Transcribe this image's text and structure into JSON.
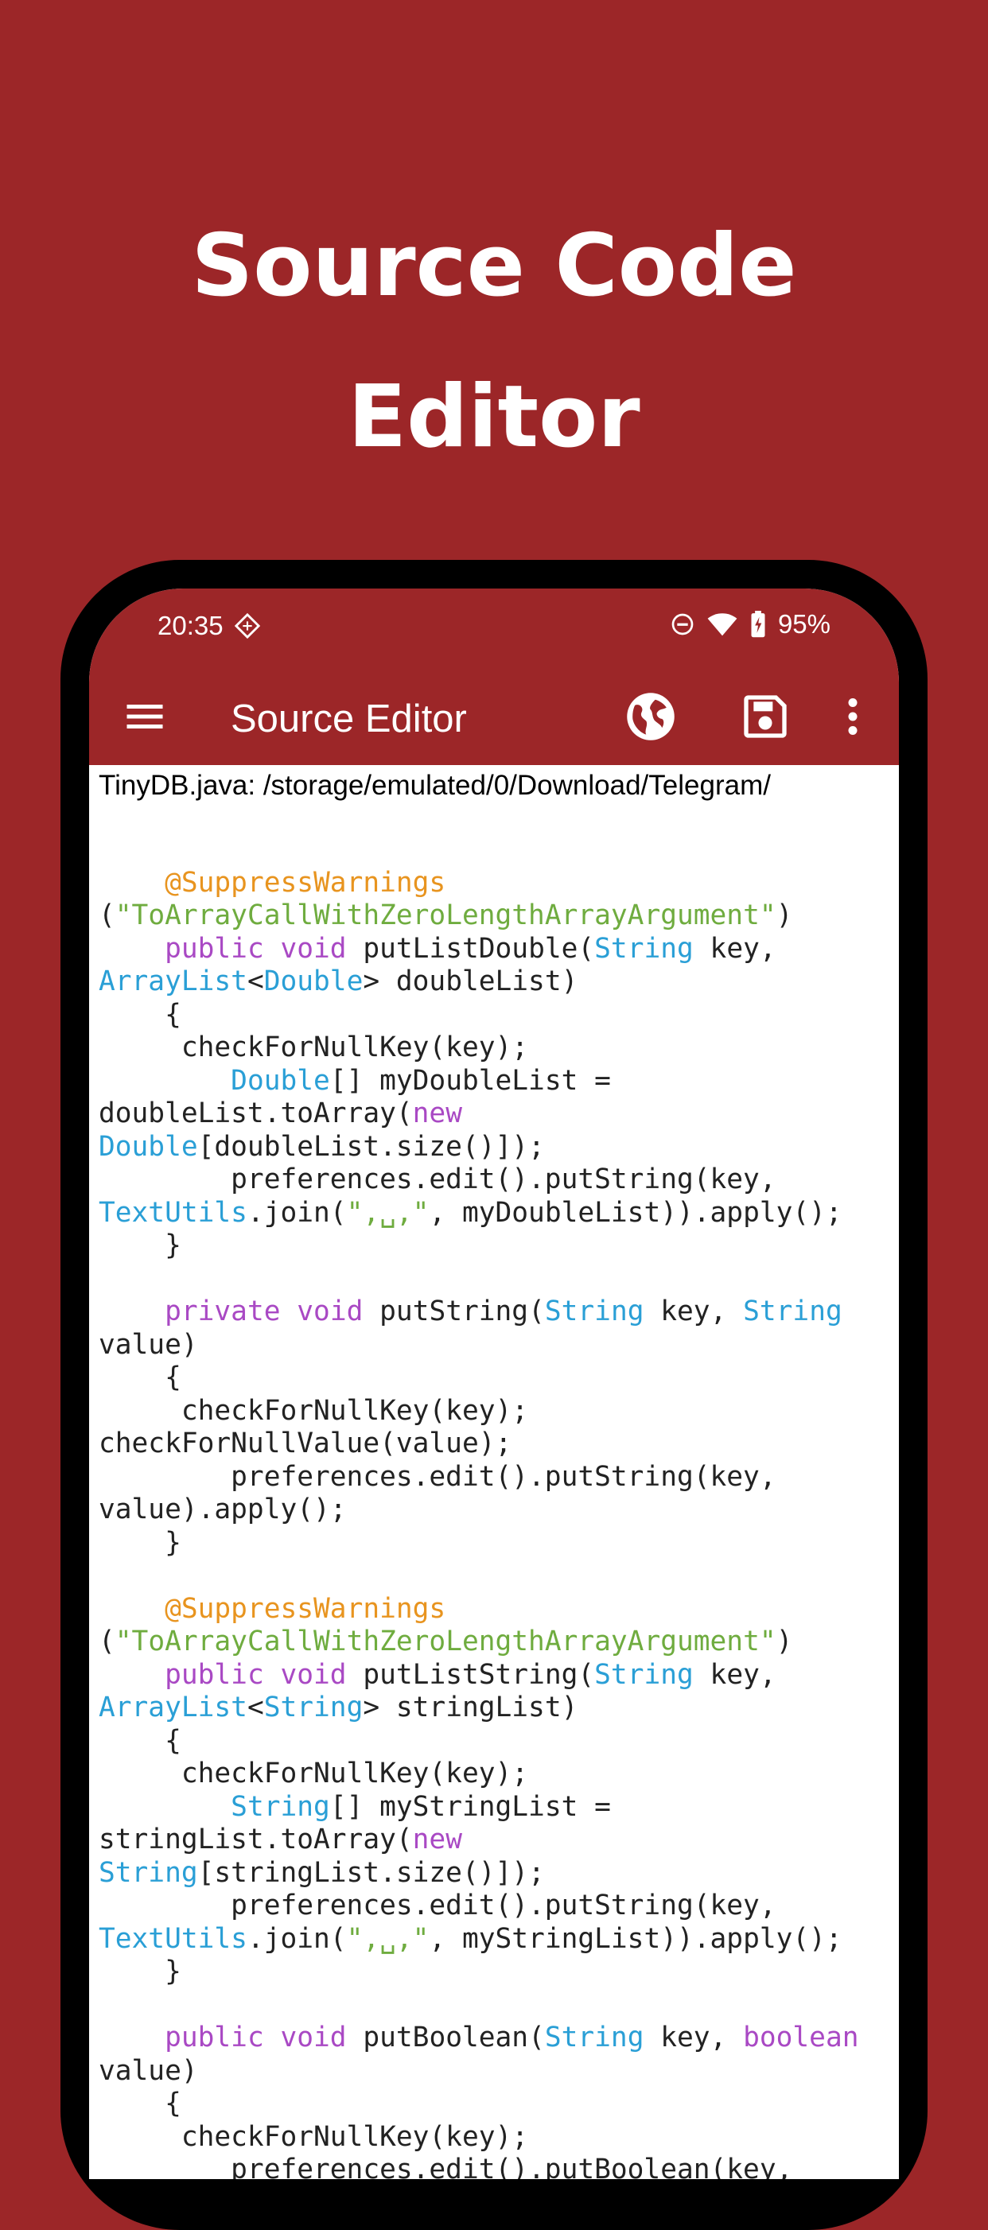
{
  "headline": {
    "line1": "Source Code",
    "line2": "Editor"
  },
  "status_bar": {
    "time": "20:35",
    "battery": "95%"
  },
  "app_bar": {
    "title": "Source Editor"
  },
  "file_path": "TinyDB.java: /storage/emulated/0/Download/Telegram/",
  "colors": {
    "brand": "#9c2628",
    "keyword": "#a949c4",
    "type": "#2a9fd6",
    "annotation": "#e8941f",
    "string": "#6fac3f"
  },
  "icons": [
    "menu-icon",
    "globe-icon",
    "save-icon",
    "more-vert-icon",
    "dnd-icon",
    "wifi-icon",
    "battery-icon",
    "sim-icon"
  ],
  "code_lines": [
    [],
    [
      [
        "    ",
        "p"
      ],
      [
        "@SuppressWarnings",
        "ann"
      ]
    ],
    [
      [
        "(",
        "p"
      ],
      [
        "\"ToArrayCallWithZeroLengthArrayArgument\"",
        "str"
      ],
      [
        ")",
        "p"
      ]
    ],
    [
      [
        "    ",
        "p"
      ],
      [
        "public",
        "kw"
      ],
      [
        " ",
        "p"
      ],
      [
        "void",
        "kw"
      ],
      [
        " putListDouble(",
        "p"
      ],
      [
        "String",
        "type"
      ],
      [
        " key,",
        "p"
      ]
    ],
    [
      [
        "ArrayList",
        "type"
      ],
      [
        "<",
        "p"
      ],
      [
        "Double",
        "type"
      ],
      [
        "> doubleList)",
        "p"
      ]
    ],
    [
      [
        "    {",
        "p"
      ]
    ],
    [
      [
        "     checkForNullKey(key);",
        "p"
      ]
    ],
    [
      [
        "        ",
        "p"
      ],
      [
        "Double",
        "type"
      ],
      [
        "[] myDoubleList =",
        "p"
      ]
    ],
    [
      [
        "doubleList.toArray(",
        "p"
      ],
      [
        "new",
        "kw"
      ]
    ],
    [
      [
        "Double",
        "type"
      ],
      [
        "[doubleList.size()]);",
        "p"
      ]
    ],
    [
      [
        "        preferences.edit().putString(key,",
        "p"
      ]
    ],
    [
      [
        "TextUtils",
        "type"
      ],
      [
        ".join(",
        "p"
      ],
      [
        "\",␣,\"",
        "str"
      ],
      [
        ", myDoubleList)).apply();",
        "p"
      ]
    ],
    [
      [
        "    }",
        "p"
      ]
    ],
    [],
    [
      [
        "    ",
        "p"
      ],
      [
        "private",
        "kw"
      ],
      [
        " ",
        "p"
      ],
      [
        "void",
        "kw"
      ],
      [
        " putString(",
        "p"
      ],
      [
        "String",
        "type"
      ],
      [
        " key, ",
        "p"
      ],
      [
        "String",
        "type"
      ]
    ],
    [
      [
        "value)",
        "p"
      ]
    ],
    [
      [
        "    {",
        "p"
      ]
    ],
    [
      [
        "     checkForNullKey(key);",
        "p"
      ]
    ],
    [
      [
        "checkForNullValue(value);",
        "p"
      ]
    ],
    [
      [
        "        preferences.edit().putString(key,",
        "p"
      ]
    ],
    [
      [
        "value).apply();",
        "p"
      ]
    ],
    [
      [
        "    }",
        "p"
      ]
    ],
    [],
    [
      [
        "    ",
        "p"
      ],
      [
        "@SuppressWarnings",
        "ann"
      ]
    ],
    [
      [
        "(",
        "p"
      ],
      [
        "\"ToArrayCallWithZeroLengthArrayArgument\"",
        "str"
      ],
      [
        ")",
        "p"
      ]
    ],
    [
      [
        "    ",
        "p"
      ],
      [
        "public",
        "kw"
      ],
      [
        " ",
        "p"
      ],
      [
        "void",
        "kw"
      ],
      [
        " putListString(",
        "p"
      ],
      [
        "String",
        "type"
      ],
      [
        " key,",
        "p"
      ]
    ],
    [
      [
        "ArrayList",
        "type"
      ],
      [
        "<",
        "p"
      ],
      [
        "String",
        "type"
      ],
      [
        "> stringList)",
        "p"
      ]
    ],
    [
      [
        "    {",
        "p"
      ]
    ],
    [
      [
        "     checkForNullKey(key);",
        "p"
      ]
    ],
    [
      [
        "        ",
        "p"
      ],
      [
        "String",
        "type"
      ],
      [
        "[] myStringList =",
        "p"
      ]
    ],
    [
      [
        "stringList.toArray(",
        "p"
      ],
      [
        "new",
        "kw"
      ]
    ],
    [
      [
        "String",
        "type"
      ],
      [
        "[stringList.size()]);",
        "p"
      ]
    ],
    [
      [
        "        preferences.edit().putString(key,",
        "p"
      ]
    ],
    [
      [
        "TextUtils",
        "type"
      ],
      [
        ".join(",
        "p"
      ],
      [
        "\",␣,\"",
        "str"
      ],
      [
        ", myStringList)).apply();",
        "p"
      ]
    ],
    [
      [
        "    }",
        "p"
      ]
    ],
    [],
    [
      [
        "    ",
        "p"
      ],
      [
        "public",
        "kw"
      ],
      [
        " ",
        "p"
      ],
      [
        "void",
        "kw"
      ],
      [
        " putBoolean(",
        "p"
      ],
      [
        "String",
        "type"
      ],
      [
        " key, ",
        "p"
      ],
      [
        "boolean",
        "kw"
      ]
    ],
    [
      [
        "value)",
        "p"
      ]
    ],
    [
      [
        "    {",
        "p"
      ]
    ],
    [
      [
        "     checkForNullKey(key);",
        "p"
      ]
    ],
    [
      [
        "        preferences.edit().putBoolean(key,",
        "p"
      ]
    ]
  ]
}
